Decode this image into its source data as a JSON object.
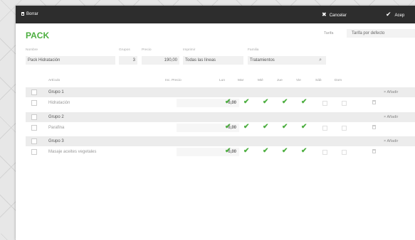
{
  "toolbar": {
    "delete_label": "Borrar",
    "cancel_label": "Cancelar",
    "accept_label": "Acep"
  },
  "page": {
    "title": "PACK",
    "tarifa_label": "Tarifa",
    "tarifa_value": "Tarifa por defecto"
  },
  "form": {
    "nombre": {
      "label": "Nombre",
      "value": "Pack Hidratación"
    },
    "grupos": {
      "label": "Grupos",
      "value": "3"
    },
    "precio": {
      "label": "Precio",
      "value": "190,00"
    },
    "imprimir": {
      "label": "Imprimir",
      "value": "Todas las líneas"
    },
    "familia": {
      "label": "Familia",
      "value": "Tratamientos"
    }
  },
  "table": {
    "headers": {
      "articulo": "Artículo",
      "inc_precio": "Inc. Precio",
      "days": [
        "Lun",
        "Mar",
        "Mié",
        "Jue",
        "Vie",
        "Sáb",
        "Dom"
      ]
    },
    "add_label": "Añadir",
    "rows": [
      {
        "type": "group",
        "name": "Grupo 1"
      },
      {
        "type": "item",
        "name": "Hidratación",
        "price": "0,00"
      },
      {
        "type": "group",
        "name": "Grupo 2"
      },
      {
        "type": "item",
        "name": "Parafina",
        "price": "0,00"
      },
      {
        "type": "group",
        "name": "Grupo 3"
      },
      {
        "type": "item",
        "name": "Masaje aceites vegetales",
        "price": "0,00"
      }
    ]
  },
  "colors": {
    "accent": "#4cae3f",
    "toolbar_bg": "#2d2d2d",
    "group_bg": "#ececec"
  },
  "icons": {
    "delete": "trash-icon",
    "cancel": "close-icon",
    "accept": "check-icon",
    "day_active": "check-icon",
    "row_delete": "trash-icon",
    "add": "plus-icon"
  }
}
